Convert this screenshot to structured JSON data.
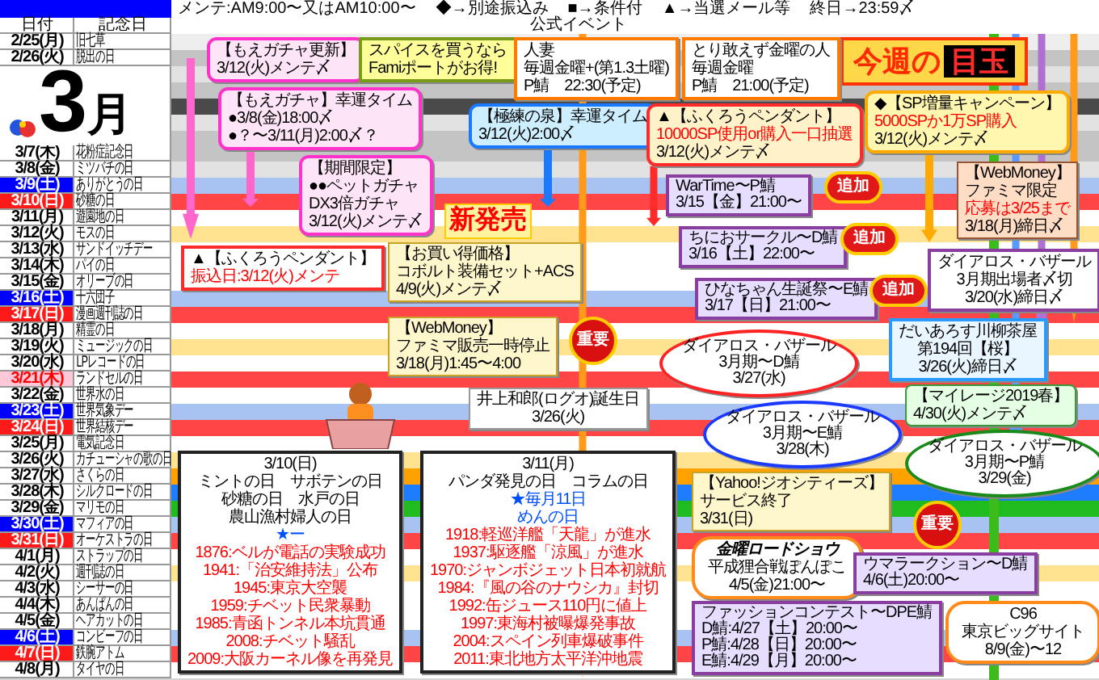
{
  "legend": [
    "メンテ:AM9:00〜又はAM10:00〜",
    "◆→別途振込み",
    "■→条件付",
    "▲→当選メール等",
    "終日→23:59〆"
  ],
  "columns": {
    "date": "日付",
    "memorial": "記念日",
    "official": "公式イベント"
  },
  "month": {
    "number": "3",
    "unit": "月"
  },
  "top_rows": [
    {
      "date": "2/25(月)",
      "kind": "weekday",
      "memorial": "旧七草",
      "color": "#eeeeee"
    },
    {
      "date": "2/26(火)",
      "kind": "weekday",
      "memorial": "脱出の日",
      "color": "#c4c4c4"
    }
  ],
  "past_bands": [
    {
      "color": "#e2e2e2"
    },
    {
      "color": "#c4c4c4"
    },
    {
      "color": "#4a4a4a"
    },
    {
      "color": "#e2e2e2"
    },
    {
      "color": "#c4c4c4"
    }
  ],
  "rows": [
    {
      "date": "3/7(木)",
      "kind": "weekday",
      "memorial": "花粉症記念日",
      "color": "#c4c4c4"
    },
    {
      "date": "3/8(金)",
      "kind": "weekday",
      "memorial": "ミツバチの日",
      "color": "#e2e2e2"
    },
    {
      "date": "3/9(土)",
      "kind": "saturday",
      "memorial": "ありがとうの日",
      "color": "#a8c2f2"
    },
    {
      "date": "3/10(日)",
      "kind": "sunday",
      "memorial": "砂糖の日",
      "color": "#ff4545"
    },
    {
      "date": "3/11(月)",
      "kind": "weekday",
      "memorial": "遊園地の日",
      "color": "#ffffff"
    },
    {
      "date": "3/12(火)",
      "kind": "weekday",
      "memorial": "モスの日",
      "color": "#ffe390"
    },
    {
      "date": "3/13(水)",
      "kind": "weekday",
      "memorial": "サンドイッチデー",
      "color": "#ffffff"
    },
    {
      "date": "3/14(木)",
      "kind": "weekday",
      "memorial": "パイの日",
      "color": "#ffffff"
    },
    {
      "date": "3/15(金)",
      "kind": "weekday",
      "memorial": "オリーブの日",
      "color": "#ffffff"
    },
    {
      "date": "3/16(土)",
      "kind": "saturday",
      "memorial": "十六団子",
      "color": "#a8c2f2"
    },
    {
      "date": "3/17(日)",
      "kind": "sunday",
      "memorial": "漫画週刊誌の日",
      "color": "#ff4545"
    },
    {
      "date": "3/18(月)",
      "kind": "weekday",
      "memorial": "精霊の日",
      "color": "#ffffff"
    },
    {
      "date": "3/19(火)",
      "kind": "weekday",
      "memorial": "ミュージックの日",
      "color": "#ffe390"
    },
    {
      "date": "3/20(水)",
      "kind": "weekday",
      "memorial": "LPレコードの日",
      "color": "#ffffff"
    },
    {
      "date": "3/21(木)",
      "kind": "holiday",
      "memorial": "ランドセルの日",
      "color": "#ff4545"
    },
    {
      "date": "3/22(金)",
      "kind": "weekday",
      "memorial": "世界水の日",
      "color": "#ffffff"
    },
    {
      "date": "3/23(土)",
      "kind": "saturday",
      "memorial": "世界気象デー",
      "color": "#a8c2f2"
    },
    {
      "date": "3/24(日)",
      "kind": "sunday",
      "memorial": "世界結核デー",
      "color": "#ff4545"
    },
    {
      "date": "3/25(月)",
      "kind": "weekday",
      "memorial": "電気記念日",
      "color": "#ffffff"
    },
    {
      "date": "3/26(火)",
      "kind": "weekday",
      "memorial": "カチューシャの歌の日",
      "color": "#ffe390"
    },
    {
      "date": "3/27(水)",
      "kind": "weekday",
      "memorial": "さくらの日",
      "color": "#ffa200"
    },
    {
      "date": "3/28(木)",
      "kind": "weekday",
      "memorial": "シルクロードの日",
      "color": "#1e7cff"
    },
    {
      "date": "3/29(金)",
      "kind": "weekday",
      "memorial": "マリモの日",
      "color": "#1fbb1f"
    },
    {
      "date": "3/30(土)",
      "kind": "saturday",
      "memorial": "マフィアの日",
      "color": "#a8c2f2"
    },
    {
      "date": "3/31(日)",
      "kind": "sunday",
      "memorial": "オーケストラの日",
      "color": "#ff4545"
    },
    {
      "date": "4/1(月)",
      "kind": "weekday",
      "memorial": "ストラップの日",
      "color": "#ffffff"
    },
    {
      "date": "4/2(火)",
      "kind": "weekday",
      "memorial": "週刊誌の日",
      "color": "#ffe390"
    },
    {
      "date": "4/3(水)",
      "kind": "weekday",
      "memorial": "シーサーの日",
      "color": "#ffffff"
    },
    {
      "date": "4/4(木)",
      "kind": "weekday",
      "memorial": "あんぱんの日",
      "color": "#ffffff"
    },
    {
      "date": "4/5(金)",
      "kind": "weekday",
      "memorial": "ヘアカットの日",
      "color": "#ffffff"
    },
    {
      "date": "4/6(土)",
      "kind": "saturday",
      "memorial": "コンビーフの日",
      "color": "#a8c2f2"
    },
    {
      "date": "4/7(日)",
      "kind": "sunday",
      "memorial": "鉄腕アトム",
      "color": "#ff4545"
    },
    {
      "date": "4/8(月)",
      "kind": "weekday",
      "memorial": "タイヤの日",
      "color": "#ffffff"
    }
  ],
  "banner": {
    "lead": "今週の",
    "main": "目玉"
  },
  "callouts": [
    {
      "kind": "pink",
      "lines": [
        "【もえガチャ更新】",
        "3/12(火)メンテ〆"
      ]
    },
    {
      "kind": "note",
      "lines": [
        "スパイスを買うなら",
        "Famiポートがお得!"
      ]
    },
    {
      "kind": "orange",
      "lines": [
        "人妻",
        "毎週金曜+(第1.3土曜)",
        "P鯖　22:30(予定)"
      ]
    },
    {
      "kind": "orange",
      "lines": [
        "とり敢えず金曜の人",
        "毎週金曜",
        "P鯖　21:00(予定)"
      ]
    },
    {
      "kind": "pink",
      "lines": [
        "【もえガチャ】幸運タイム",
        "●3/8(金)18:00〆",
        "●？〜3/11(月)2:00〆？"
      ]
    },
    {
      "kind": "blue",
      "lines": [
        "【極練の泉】幸運タイム",
        "3/12(火)2:00〆"
      ]
    },
    {
      "kind": "red",
      "lines": [
        "▲【ふくろうペンダント】",
        {
          "text": "10000SP使用or購入一口抽選",
          "color": "#ff0000"
        },
        "3/12(火)メンテ〆"
      ]
    },
    {
      "kind": "gold",
      "lines": [
        "◆【SP増量キャンペーン】",
        {
          "text": "5000SPか1万SP購入",
          "color": "#ff0000"
        },
        "3/12(火)メンテ〆"
      ]
    },
    {
      "kind": "pink",
      "lines": [
        "【期間限定】",
        "●●ペットガチャ",
        "DX3倍ガチャ",
        "3/12(火)メンテ〆"
      ]
    },
    {
      "kind": "lavender",
      "lines": [
        "WarTime〜P鯖",
        "3/15【金】21:00〜"
      ]
    },
    {
      "kind": "peach",
      "lines": [
        "【WebMoney】",
        "ファミマ限定",
        {
          "text": "応募は3/25まで",
          "color": "#ff0000"
        },
        "3/18(月)締日〆"
      ]
    },
    {
      "kind": "lavender",
      "lines": [
        "ちにおサークル〜D鯖",
        "3/16【土】22:00〜"
      ]
    },
    {
      "kind": "redbox",
      "lines": [
        "▲【ふくろうペンダント】",
        {
          "text": "振込日:3/12(火)メンテ",
          "color": "#ff0000"
        }
      ]
    },
    {
      "kind": "cream",
      "lines": [
        "【お買い得価格】",
        "コボルト装備セット+ACS",
        "4/9(火)メンテ〆"
      ]
    },
    {
      "kind": "lavender",
      "lines": [
        "ひなちゃん生誕祭〜E鯖",
        "3/17【日】21:00〜"
      ]
    },
    {
      "kind": "purple",
      "lines": [
        "ダイアロス・バザール",
        "3月期出場者〆切",
        "3/20(水)締日〆"
      ]
    },
    {
      "kind": "cream",
      "lines": [
        "【WebMoney】",
        "ファミマ販売一時停止",
        "3/18(月)1:45〜4:00"
      ]
    },
    {
      "kind": "sky",
      "lines": [
        "だいあろす川柳茶屋",
        "第194回【桜】",
        "3/26(火)締日〆"
      ]
    },
    {
      "kind": "redoval",
      "lines": [
        "ダイアロス・バザール",
        "3月期〜D鯖",
        "3/27(水)"
      ]
    },
    {
      "kind": "white",
      "lines": [
        "井上和郎(ログオ)誕生日",
        "3/26(火)"
      ]
    },
    {
      "kind": "green",
      "lines": [
        "【マイレージ2019春】",
        "4/30(火)メンテ〆"
      ]
    },
    {
      "kind": "blueoval",
      "lines": [
        "ダイアロス・バザール",
        "3月期〜E鯖",
        "3/28(木)"
      ]
    },
    {
      "kind": "greenoval",
      "lines": [
        "ダイアロス・バザール",
        "3月期〜P鯖",
        "3/29(金)"
      ]
    },
    {
      "kind": "cream",
      "lines": [
        "【Yahoo!ジオシティーズ】",
        "サービス終了",
        "3/31(日)"
      ]
    },
    {
      "kind": "history",
      "lines": [
        "3/10(日)",
        "ミントの日　サボテンの日",
        "砂糖の日　水戸の日",
        "農山漁村婦人の日",
        {
          "text": "★ー",
          "color": "#0050ff"
        },
        {
          "text": "1876:ベルが電話の実験成功",
          "color": "#ff0000"
        },
        {
          "text": "1941:「治安維持法」公布",
          "color": "#ff0000"
        },
        {
          "text": "1945:東京大空襲",
          "color": "#ff0000"
        },
        {
          "text": "1959:チベット民衆暴動",
          "color": "#ff0000"
        },
        {
          "text": "1985:青函トンネル本坑貫通",
          "color": "#ff0000"
        },
        {
          "text": "2008:チベット騒乱",
          "color": "#ff0000"
        },
        {
          "text": "2009:大阪カーネル像を再発見",
          "color": "#ff0000"
        }
      ]
    },
    {
      "kind": "history",
      "lines": [
        "3/11(月)",
        "パンダ発見の日　コラムの日",
        {
          "text": "★毎月11日",
          "color": "#0050ff"
        },
        {
          "text": "めんの日",
          "color": "#0050ff"
        },
        {
          "text": "1918:軽巡洋艦「天龍」が進水",
          "color": "#ff0000"
        },
        {
          "text": "1937:駆逐艦「涼風」が進水",
          "color": "#ff0000"
        },
        {
          "text": "1970:ジャンボジェット日本初就航",
          "color": "#ff0000"
        },
        {
          "text": "1984:『風の谷のナウシカ』封切",
          "color": "#ff0000"
        },
        {
          "text": "1992:缶ジュース110円に値上",
          "color": "#ff0000"
        },
        {
          "text": "1997:東海村被曝爆発事故",
          "color": "#ff0000"
        },
        {
          "text": "2004:スペイン列車爆破事件",
          "color": "#ff0000"
        },
        {
          "text": "2011:東北地方太平洋沖地震",
          "color": "#ff0000"
        }
      ]
    },
    {
      "kind": "amber",
      "lines": [
        {
          "text": "金曜ロードショウ",
          "kind": "title"
        },
        "平成狸合戦ぽんぽこ",
        "4/5(金)21:00〜"
      ]
    },
    {
      "kind": "lavender",
      "lines": [
        "ウマラークション〜D鯖",
        "4/6(土)20:00〜"
      ]
    },
    {
      "kind": "lavender",
      "lines": [
        "ファッションコンテスト〜DPE鯖",
        "D鯖:4/27【土】20:00〜",
        "P鯖:4/28【日】20:00〜",
        "E鯖:4/29【月】20:00〜"
      ]
    },
    {
      "kind": "amber",
      "lines": [
        "C96",
        "東京ビッグサイト",
        "8/9(金)〜12"
      ]
    }
  ],
  "badges": [
    {
      "kind": "new",
      "text": "新発売"
    },
    {
      "kind": "add",
      "text": "追加"
    },
    {
      "kind": "add",
      "text": "追加"
    },
    {
      "kind": "add",
      "text": "追加"
    },
    {
      "kind": "important",
      "text": "重要"
    },
    {
      "kind": "important",
      "text": "重要"
    }
  ]
}
